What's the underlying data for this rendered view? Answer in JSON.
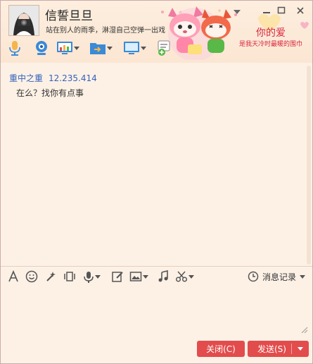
{
  "header": {
    "nickname": "信誓旦旦",
    "signature": "站在别人的雨季，淋湿自己空弹一出戏"
  },
  "banner": {
    "title": "你的爱",
    "subtitle": "是我天冷时最暖的围巾"
  },
  "chat": {
    "messages": [
      {
        "sender": "重中之重",
        "time": "12.235.414",
        "text": "在么？找你有点事"
      }
    ]
  },
  "format_toolbar": {
    "history_label": "消息记录"
  },
  "buttons": {
    "close_label": "关闭(C)",
    "send_label": "发送(S)"
  },
  "colors": {
    "accent_red": "#e24c4c",
    "sender_blue": "#3361b9",
    "background": "#fdf1e6"
  }
}
